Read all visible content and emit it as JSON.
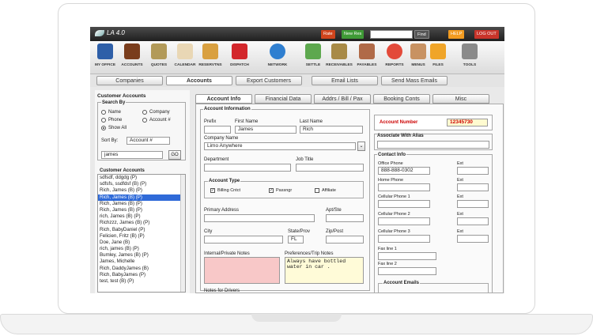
{
  "app": {
    "title": "LA 4.0"
  },
  "topbar": {
    "rate": "Rate",
    "new_res": "New Res",
    "find": "Find",
    "help": "HELP",
    "logout": "LOG OUT"
  },
  "toolbar": [
    {
      "label": "MY OFFICE",
      "icon": "office-icon",
      "color": "#2e5fa8"
    },
    {
      "label": "ACCOUNTS",
      "icon": "book-icon",
      "color": "#7a3d1c"
    },
    {
      "label": "QUOTES",
      "icon": "moneybag-icon",
      "color": "#b29a59"
    },
    {
      "label": "CALENDAR",
      "icon": "calendar-icon",
      "color": "#e9d7b5"
    },
    {
      "label": "RESERVTNS",
      "icon": "notepad-icon",
      "color": "#d9a040"
    },
    {
      "label": "DISPATCH",
      "icon": "car-icon",
      "color": "#d3272c"
    },
    {
      "label": "NETWORK",
      "icon": "globe-icon",
      "color": "#2f7fd0"
    },
    {
      "label": "SETTLE",
      "icon": "cash-icon",
      "color": "#5da84e"
    },
    {
      "label": "RECEIVABLES",
      "icon": "tray-in-icon",
      "color": "#a88a46"
    },
    {
      "label": "PAYABLES",
      "icon": "tray-out-icon",
      "color": "#b06a48"
    },
    {
      "label": "REPORTS",
      "icon": "pie-chart-icon",
      "color": "#e34a3a"
    },
    {
      "label": "MENUS",
      "icon": "hand-icon",
      "color": "#c89262"
    },
    {
      "label": "FILES",
      "icon": "folder-icon",
      "color": "#f0a529"
    },
    {
      "label": "TOOLS",
      "icon": "tools-icon",
      "color": "#8a8a8a"
    }
  ],
  "nav_tabs": [
    "Companies",
    "Accounts",
    "Export Customers",
    "Email Lists",
    "Send Mass Emails"
  ],
  "left": {
    "title": "Customer Accounts",
    "search_by": "Search By",
    "radios": [
      "Name",
      "Company",
      "Phone",
      "Account #",
      "Show All"
    ],
    "sort_by": "Sort By:",
    "sort_value": "Account #",
    "search_value": "james",
    "go": "GO",
    "list_title": "Customer Accounts",
    "accounts": [
      "sdfsdf, ddgdg (P)",
      "sdfsfs, ssdfdsf (B) (P)",
      "Rich, James (B) (P)",
      "Rich, James (B) (P)",
      "Rich, James (B) (P)",
      "Rich, James (B) (P)",
      "rich, James (B) (P)",
      "Richzzz, James (B) (P)",
      "Rich, BabyDaniel (P)",
      "Felicien, Fritz (B) (P)",
      "Doe, Jane (B)",
      "rich, james (B) (P)",
      "Bumley, James (B) (P)",
      "James, Michelle",
      "Rich, DaddyJames (B)",
      "Rich, BabyJames (P)",
      "test, test (B) (P)"
    ],
    "selected_index": 3
  },
  "subtabs": [
    "Account Info",
    "Financial Data",
    "Addrs / Bill / Pax",
    "Booking Conts",
    "Misc"
  ],
  "form": {
    "account_info": "Account Information",
    "prefix": "Prefix",
    "first_name_label": "First Name",
    "first_name": "James",
    "last_name_label": "Last Name",
    "last_name": "Rich",
    "company_label": "Company Name",
    "company": "Limo Anywhere",
    "department": "Department",
    "job_title": "Job Title",
    "account_type": "Account Type",
    "types": [
      "Billing Cntct",
      "Passngr",
      "Affiliate"
    ],
    "primary_address": "Primary Address",
    "apt": "Apt/Ste",
    "city": "City",
    "state_label": "State/Prov",
    "state": "FL",
    "zip": "Zip/Post",
    "internal_notes": "Internal/Private Notes",
    "pref_notes": "Preferences/Trip Notes",
    "pref_text": "Always have bottled water in car .",
    "notes_drivers": "Notes for Drivers",
    "account_number_label": "Account Number",
    "account_number": "12345730",
    "assoc_alias": "Associate With Alias",
    "contact_info": "Contact Info",
    "office_phone": "Office Phone",
    "office_phone_value": "888-888-0302",
    "ext": "Ext",
    "home_phone": "Home Phone",
    "cell1": "Cellular Phone 1",
    "cell2": "Cellular Phone 2",
    "cell3": "Cellular Phone 3",
    "fax1": "Fax line 1",
    "fax2": "Fax line 2",
    "account_emails": "Account Emails"
  }
}
